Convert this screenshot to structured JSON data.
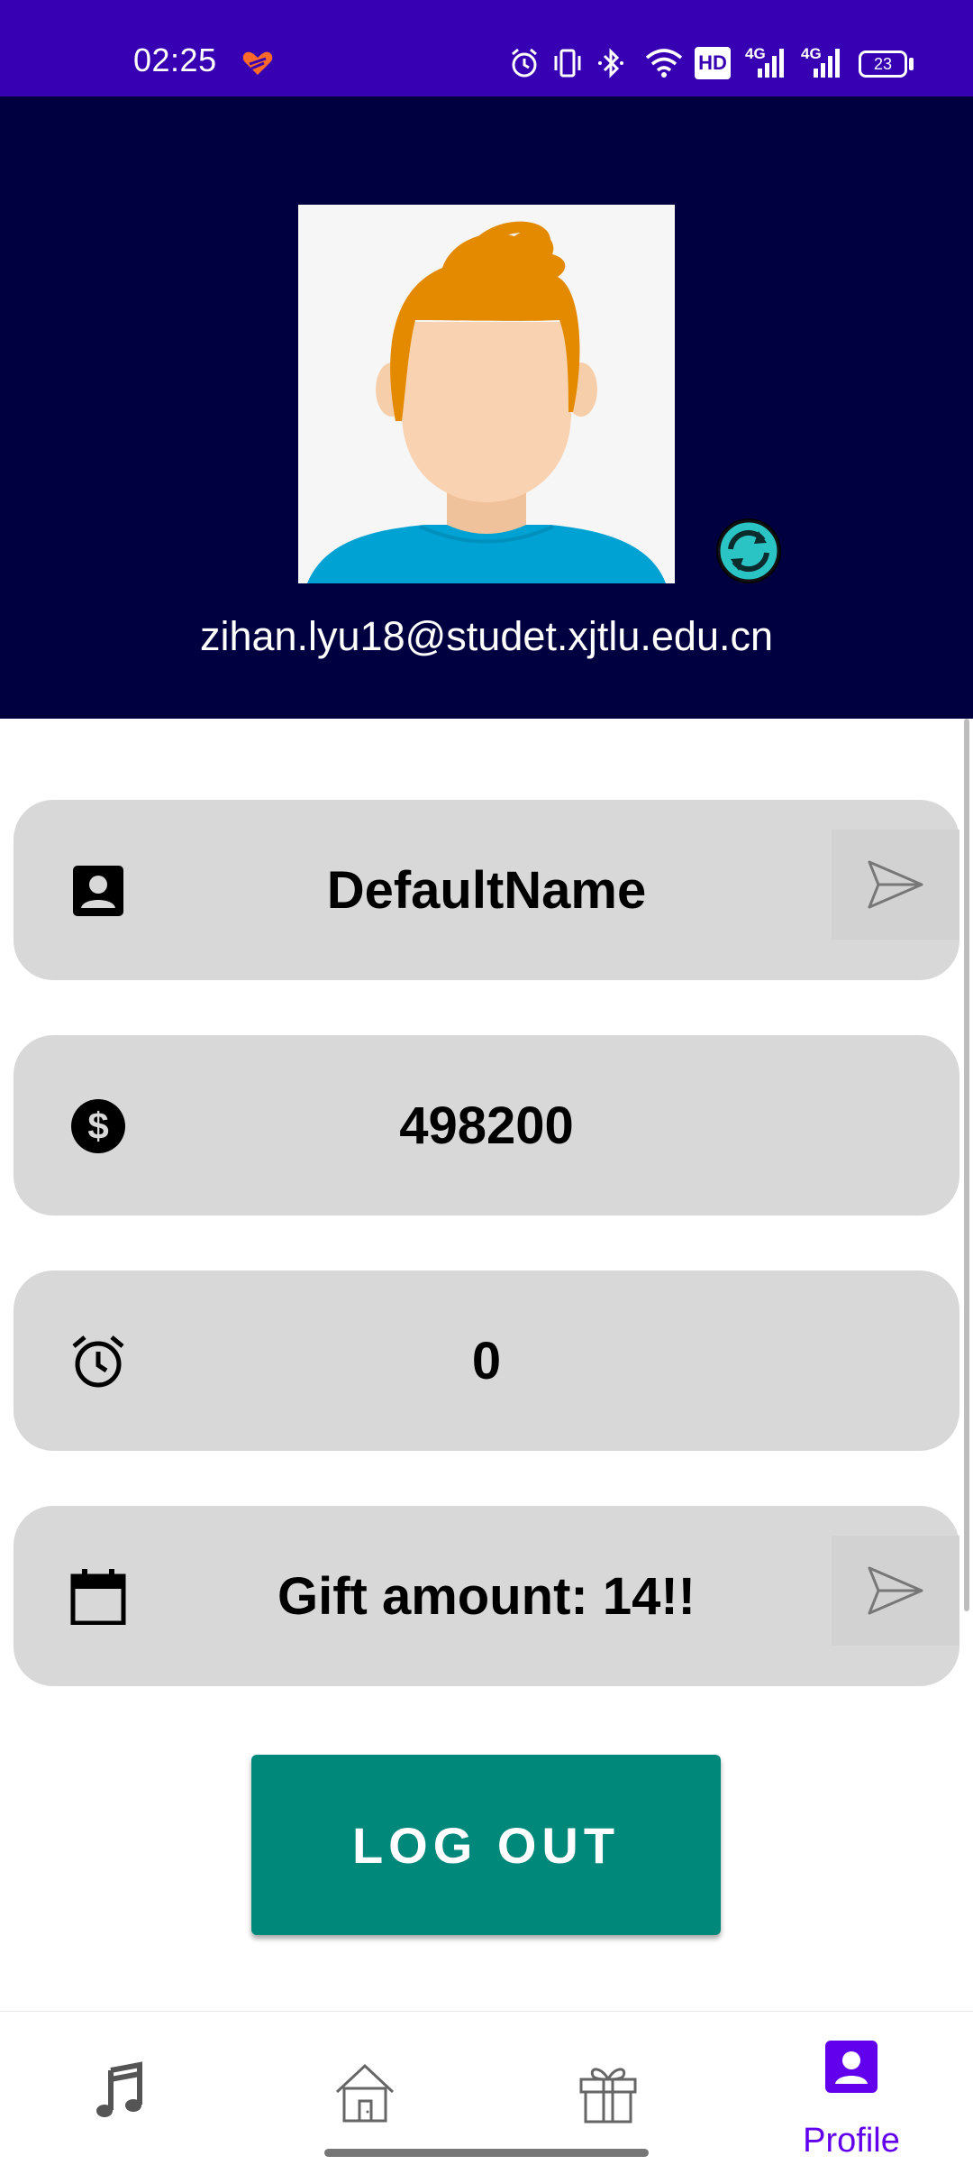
{
  "status_bar": {
    "time": "02:25",
    "hd_label": "HD",
    "net1_label": "4G",
    "net2_label": "4G",
    "battery": "23",
    "icons": [
      "heart-icon",
      "alarm-icon",
      "vibrate-icon",
      "bluetooth-icon",
      "wifi-icon",
      "hd-icon",
      "signal-4g-icon",
      "signal-4g-icon",
      "battery-icon"
    ]
  },
  "profile": {
    "email": "zihan.lyu18@studet.xjtlu.edu.cn"
  },
  "cards": {
    "name": {
      "value": "DefaultName",
      "icon": "account-box-icon"
    },
    "coins": {
      "value": "498200",
      "icon": "dollar-icon"
    },
    "timer": {
      "value": "0",
      "icon": "alarm-clock-icon"
    },
    "gift": {
      "value": "Gift amount: 14!!",
      "icon": "calendar-icon"
    }
  },
  "actions": {
    "logout_label": "LOG OUT"
  },
  "bottom_nav": {
    "items": [
      {
        "id": "music",
        "icon": "music-note-icon"
      },
      {
        "id": "home",
        "icon": "home-icon"
      },
      {
        "id": "gift",
        "icon": "gift-icon"
      },
      {
        "id": "profile",
        "icon": "profile-icon",
        "label": "Profile",
        "active": true
      }
    ]
  },
  "colors": {
    "status_bar": "#3700b3",
    "header": "#000040",
    "card": "#d8d8d8",
    "logout": "#00897b",
    "active_nav": "#6200ee"
  }
}
